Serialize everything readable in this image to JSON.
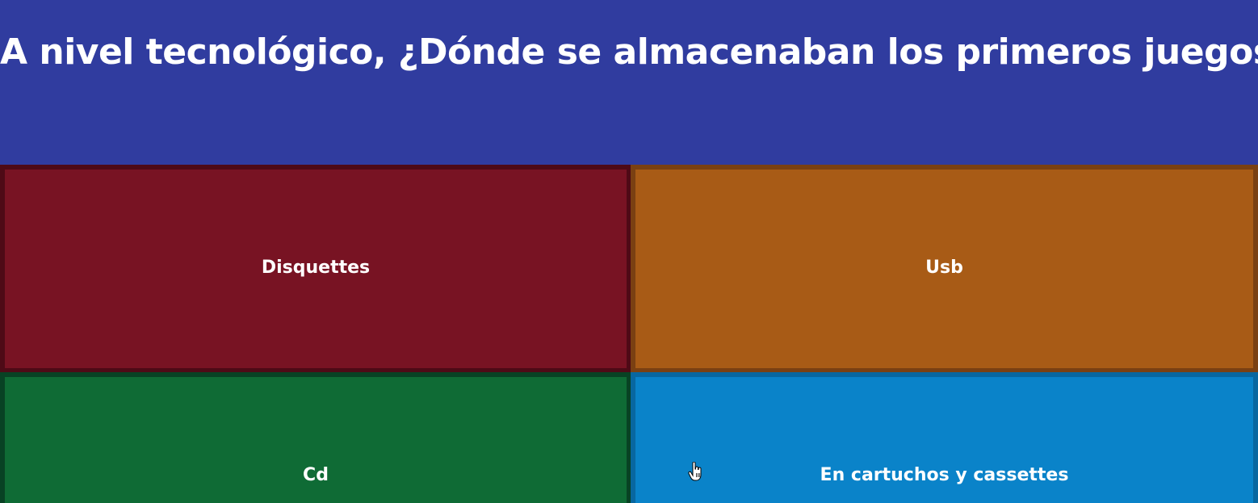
{
  "question": {
    "text": "A nivel tecnológico, ¿Dónde se almacenaban los primeros juegos?"
  },
  "answers": [
    {
      "label": "Disquettes",
      "color": "#781323"
    },
    {
      "label": "Usb",
      "color": "#a85b16"
    },
    {
      "label": "Cd",
      "color": "#0f6b35"
    },
    {
      "label": "En cartuchos y cassettes",
      "color": "#0a83c9"
    }
  ],
  "cursor": {
    "icon": "hand-pointer-icon"
  }
}
